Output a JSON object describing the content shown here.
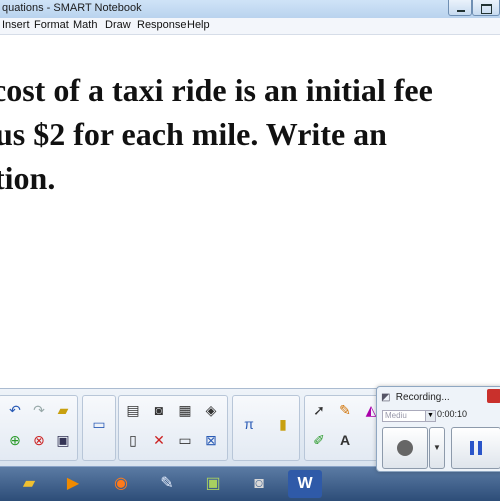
{
  "window": {
    "title": "quations - SMART Notebook"
  },
  "menu": [
    "Insert",
    "Format",
    "Math",
    "Draw",
    "Response",
    "Help"
  ],
  "canvas": {
    "lines": [
      "cost of a taxi ride is an initial fee",
      "us $2 for each mile.  Write an",
      "tion."
    ]
  },
  "recording": {
    "title": "Recording...",
    "quality": "Mediu",
    "time": "0:00:10"
  }
}
